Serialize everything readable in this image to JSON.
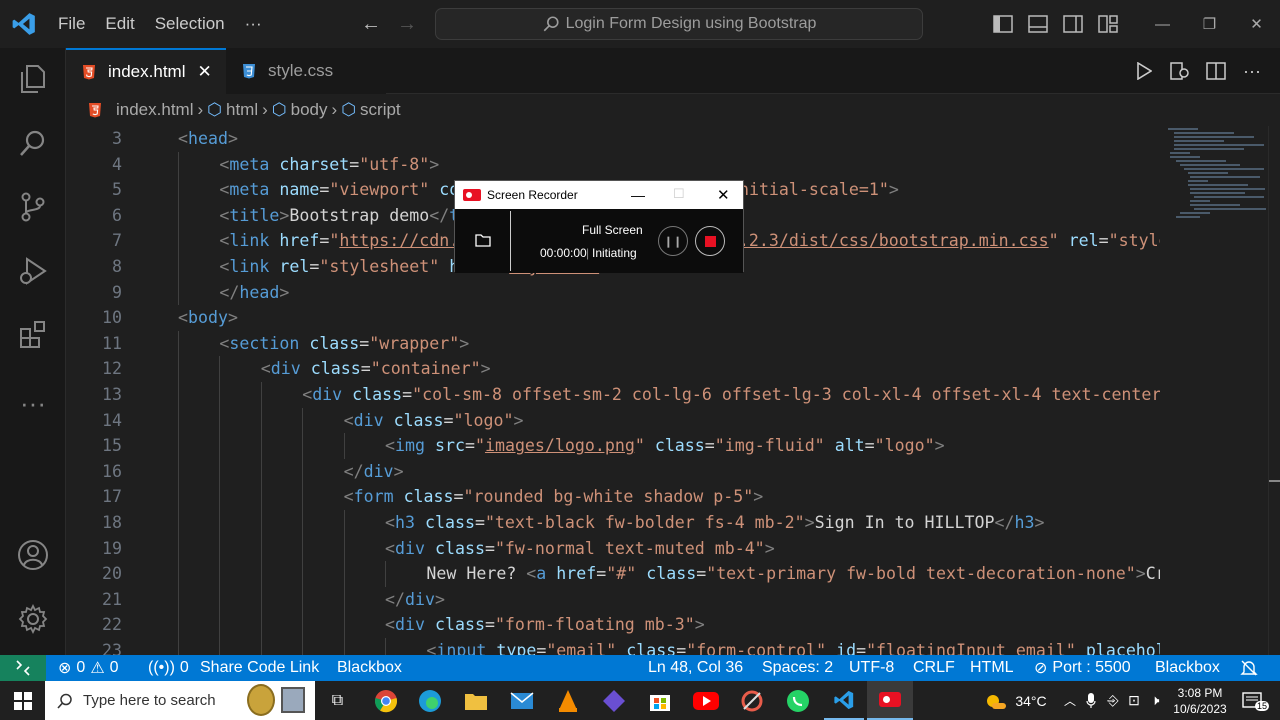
{
  "titlebar": {
    "menu": [
      "File",
      "Edit",
      "Selection",
      "···"
    ],
    "search_text": "Login Form Design using Bootstrap"
  },
  "tabs": [
    {
      "label": "index.html",
      "close": "✕"
    },
    {
      "label": "style.css"
    }
  ],
  "breadcrumb": [
    "index.html",
    "html",
    "body",
    "script"
  ],
  "editor": {
    "lines": [
      {
        "n": "3",
        "indent": 1,
        "html": "<span class='tg'>&lt;</span><span class='tn'>head</span><span class='tg'>&gt;</span>"
      },
      {
        "n": "4",
        "indent": 2,
        "html": "<span class='tg'>&lt;</span><span class='tn'>meta</span> <span class='at'>charset</span><span class='tx'>=</span><span class='st'>\"utf-8\"</span><span class='tg'>&gt;</span>"
      },
      {
        "n": "5",
        "indent": 2,
        "html": "<span class='tg'>&lt;</span><span class='tn'>meta</span> <span class='at'>name</span><span class='tx'>=</span><span class='st'>\"viewport\"</span> <span class='at'>content</span><span class='tx'>=</span><span class='st'>\"width=device-width, initial-scale=1\"</span><span class='tg'>&gt;</span>"
      },
      {
        "n": "6",
        "indent": 2,
        "html": "<span class='tg'>&lt;</span><span class='tn'>title</span><span class='tg'>&gt;</span><span class='tx'>Bootstrap demo</span><span class='tg'>&lt;/</span><span class='tn'>title</span><span class='tg'>&gt;</span>"
      },
      {
        "n": "7",
        "indent": 2,
        "html": "<span class='tg'>&lt;</span><span class='tn'>link</span> <span class='at'>href</span><span class='tx'>=</span><span class='st'>\"<span class='ul'>https://cdn.jsdelivr.net/npm/bootstrap@5.2.3/dist/css/bootstrap.min.css</span>\"</span> <span class='at'>rel</span><span class='tx'>=</span><span class='st'>\"stylesheet\"</span>"
      },
      {
        "n": "8",
        "indent": 2,
        "html": "<span class='tg'>&lt;</span><span class='tn'>link</span> <span class='at'>rel</span><span class='tx'>=</span><span class='st'>\"stylesheet\"</span> <span class='at'>href</span><span class='tx'>=</span><span class='st'>\"<span class='ul'>style.css</span>\"</span><span class='tg'>&gt;</span>"
      },
      {
        "n": "9",
        "indent": 2,
        "html": "<span class='tg'>&lt;/</span><span class='tn'>head</span><span class='tg'>&gt;</span>"
      },
      {
        "n": "10",
        "indent": 1,
        "html": "<span class='tg'>&lt;</span><span class='tn'>body</span><span class='tg'>&gt;</span>"
      },
      {
        "n": "11",
        "indent": 2,
        "html": "<span class='tg'>&lt;</span><span class='tn'>section</span> <span class='at'>class</span><span class='tx'>=</span><span class='st'>\"wrapper\"</span><span class='tg'>&gt;</span>"
      },
      {
        "n": "12",
        "indent": 3,
        "html": "<span class='tg'>&lt;</span><span class='tn'>div</span> <span class='at'>class</span><span class='tx'>=</span><span class='st'>\"container\"</span><span class='tg'>&gt;</span>"
      },
      {
        "n": "13",
        "indent": 4,
        "html": "<span class='tg'>&lt;</span><span class='tn'>div</span> <span class='at'>class</span><span class='tx'>=</span><span class='st'>\"col-sm-8 offset-sm-2 col-lg-6 offset-lg-3 col-xl-4 offset-xl-4 text-center\"</span>"
      },
      {
        "n": "14",
        "indent": 5,
        "html": "<span class='tg'>&lt;</span><span class='tn'>div</span> <span class='at'>class</span><span class='tx'>=</span><span class='st'>\"logo\"</span><span class='tg'>&gt;</span>"
      },
      {
        "n": "15",
        "indent": 6,
        "html": "<span class='tg'>&lt;</span><span class='tn'>img</span> <span class='at'>src</span><span class='tx'>=</span><span class='st'>\"<span class='ul'>images/logo.png</span>\"</span> <span class='at'>class</span><span class='tx'>=</span><span class='st'>\"img-fluid\"</span> <span class='at'>alt</span><span class='tx'>=</span><span class='st'>\"logo\"</span><span class='tg'>&gt;</span>"
      },
      {
        "n": "16",
        "indent": 5,
        "html": "<span class='tg'>&lt;/</span><span class='tn'>div</span><span class='tg'>&gt;</span>"
      },
      {
        "n": "17",
        "indent": 5,
        "html": "<span class='tg'>&lt;</span><span class='tn'>form</span> <span class='at'>class</span><span class='tx'>=</span><span class='st'>\"rounded bg-white shadow p-5\"</span><span class='tg'>&gt;</span>"
      },
      {
        "n": "18",
        "indent": 6,
        "html": "<span class='tg'>&lt;</span><span class='tn'>h3</span> <span class='at'>class</span><span class='tx'>=</span><span class='st'>\"text-black fw-bolder fs-4 mb-2\"</span><span class='tg'>&gt;</span><span class='tx'>Sign In to HILLTOP</span><span class='tg'>&lt;/</span><span class='tn'>h3</span><span class='tg'>&gt;</span>"
      },
      {
        "n": "19",
        "indent": 6,
        "html": "<span class='tg'>&lt;</span><span class='tn'>div</span> <span class='at'>class</span><span class='tx'>=</span><span class='st'>\"fw-normal text-muted mb-4\"</span><span class='tg'>&gt;</span>"
      },
      {
        "n": "20",
        "indent": 7,
        "html": "<span class='tx'>New Here? </span><span class='tg'>&lt;</span><span class='tn'>a</span> <span class='at'>href</span><span class='tx'>=</span><span class='st'>\"#\"</span> <span class='at'>class</span><span class='tx'>=</span><span class='st'>\"text-primary fw-bold text-decoration-none\"</span><span class='tg'>&gt;</span><span class='tx'>Create</span>"
      },
      {
        "n": "21",
        "indent": 6,
        "html": "<span class='tg'>&lt;/</span><span class='tn'>div</span><span class='tg'>&gt;</span>"
      },
      {
        "n": "22",
        "indent": 6,
        "html": "<span class='tg'>&lt;</span><span class='tn'>div</span> <span class='at'>class</span><span class='tx'>=</span><span class='st'>\"form-floating mb-3\"</span><span class='tg'>&gt;</span>"
      },
      {
        "n": "23",
        "indent": 7,
        "html": "<span class='tg'>&lt;</span><span class='tn'>input</span> <span class='at'>type</span><span class='tx'>=</span><span class='st'>\"email\"</span> <span class='at'>class</span><span class='tx'>=</span><span class='st'>\"form-control\"</span> <span class='at'>id</span><span class='tx'>=</span><span class='st'>\"floatingInput email\"</span> <span class='at'>placeholder</span>"
      }
    ]
  },
  "recorder": {
    "title": "Screen Recorder",
    "mode": "Full Screen",
    "time": "00:00:00",
    "status": "Initiating"
  },
  "statusbar": {
    "errors": "0",
    "warnings": "0",
    "ports_count": "0",
    "share": "Share Code Link",
    "blackbox_left": "Blackbox",
    "position": "Ln 48, Col 36",
    "spaces": "Spaces: 2",
    "encoding": "UTF-8",
    "eol": "CRLF",
    "language": "HTML",
    "port": "Port : 5500",
    "blackbox_right": "Blackbox"
  },
  "taskbar": {
    "search_placeholder": "Type here to search",
    "temperature": "34°C",
    "time": "3:08 PM",
    "date": "10/6/2023",
    "notif_count": "15"
  },
  "colors": {
    "accent": "#0078d4",
    "editor_bg": "#1f1f1f",
    "tag": "#569cd6",
    "attribute": "#9cdcfe",
    "string": "#ce9178"
  }
}
